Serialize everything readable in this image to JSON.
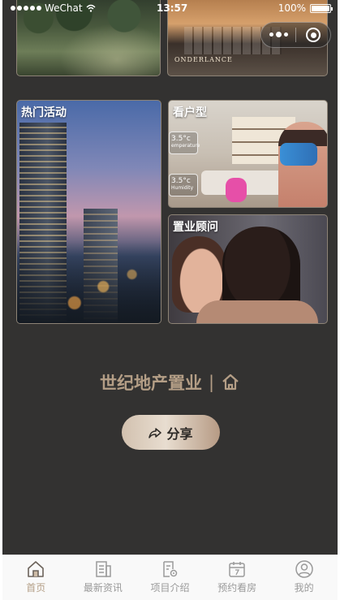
{
  "status_bar": {
    "carrier": "WeChat",
    "time": "13:57",
    "battery": "100%"
  },
  "capsule": {
    "more_icon": "more-dots-icon",
    "close_icon": "mini-program-close-icon"
  },
  "tiles": {
    "hot_activity": "热门活动",
    "house_type": "看户型",
    "advisor": "置业顾问",
    "lobby_sign": "ONDERLANCE",
    "house_ui_1": "3.5°c",
    "house_ui_1_sub": "emperature",
    "house_ui_2": "3.5°c",
    "house_ui_2_sub": "Humidity"
  },
  "brand": {
    "name": "世纪地产置业",
    "separator": "|",
    "icon": "home-outline-icon"
  },
  "share": {
    "label": "分享",
    "icon": "share-arrow-icon"
  },
  "tabbar": {
    "items": [
      {
        "label": "首页",
        "icon": "home-icon",
        "active": true
      },
      {
        "label": "最新资讯",
        "icon": "news-building-icon",
        "active": false
      },
      {
        "label": "项目介绍",
        "icon": "project-doc-icon",
        "active": false
      },
      {
        "label": "预约看房",
        "icon": "calendar-icon",
        "active": false
      },
      {
        "label": "我的",
        "icon": "user-icon",
        "active": false
      }
    ]
  },
  "colors": {
    "background": "#333231",
    "accent": "#b49e86",
    "tab_inactive": "#9a9a9a"
  }
}
